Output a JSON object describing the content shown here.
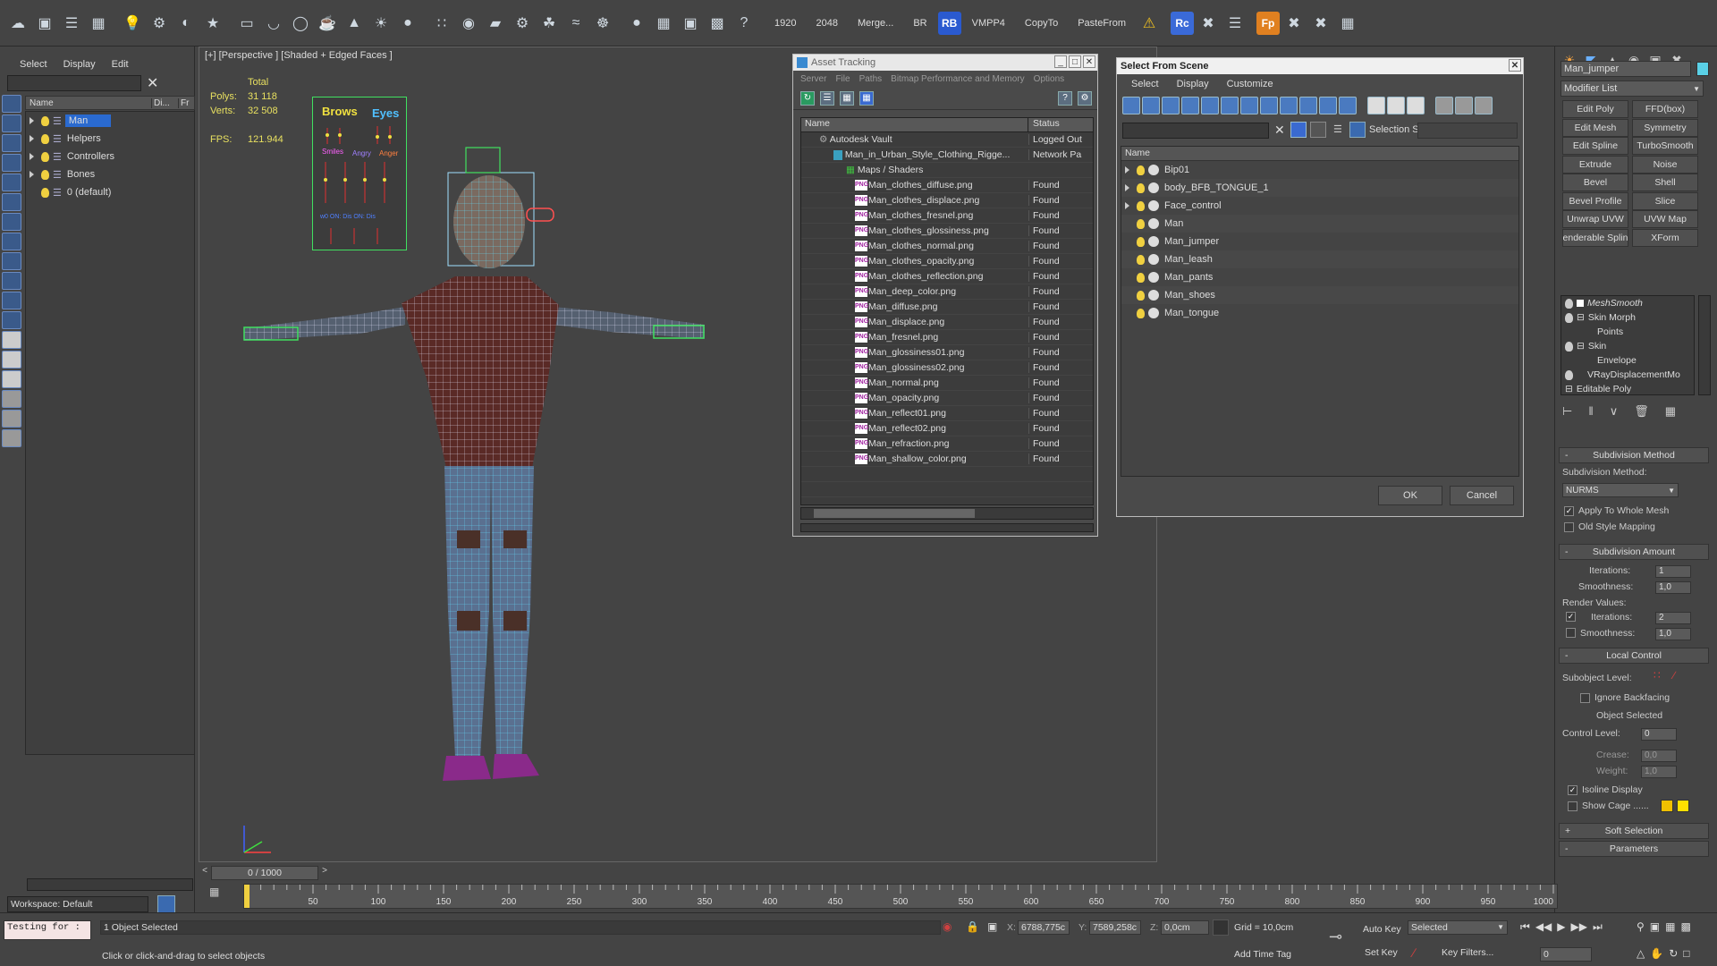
{
  "toolbar": {
    "fields": [
      "1920",
      "2048",
      "Merge...",
      "BR",
      "RB",
      "VMPP4",
      "CopyTo",
      "PasteFrom",
      "Rc",
      "Fp"
    ]
  },
  "scene_explorer": {
    "menu": [
      "Select",
      "Display",
      "Edit"
    ],
    "columns": [
      "Name",
      "Di...",
      "Fr"
    ],
    "items": [
      "Man",
      "Helpers",
      "Controllers",
      "Bones",
      "0 (default)"
    ],
    "workspace": "Workspace: Default"
  },
  "viewport": {
    "label": "[+] [Perspective ] [Shaded + Edged Faces ]",
    "stats_header": "Total",
    "polys_label": "Polys:",
    "polys_value": "31 118",
    "verts_label": "Verts:",
    "verts_value": "32 508",
    "fps_label": "FPS:",
    "fps_value": "121.944",
    "face_panel": [
      "Brows",
      "Eyes",
      "Smiles",
      "Angry",
      "Anger"
    ],
    "face_panel_bottom": "w0 ON: Dis ON: Dis"
  },
  "asset_tracking": {
    "title": "Asset Tracking",
    "menu": [
      "Server",
      "File",
      "Paths",
      "Bitmap Performance and Memory",
      "Options"
    ],
    "columns": [
      "Name",
      "Status"
    ],
    "root": {
      "name": "Autodesk Vault",
      "status": "Logged Out"
    },
    "file": {
      "name": "Man_in_Urban_Style_Clothing_Rigge...",
      "status": "Network Pa"
    },
    "folder": "Maps / Shaders",
    "maps": [
      {
        "name": "Man_clothes_diffuse.png",
        "status": "Found"
      },
      {
        "name": "Man_clothes_displace.png",
        "status": "Found"
      },
      {
        "name": "Man_clothes_fresnel.png",
        "status": "Found"
      },
      {
        "name": "Man_clothes_glossiness.png",
        "status": "Found"
      },
      {
        "name": "Man_clothes_normal.png",
        "status": "Found"
      },
      {
        "name": "Man_clothes_opacity.png",
        "status": "Found"
      },
      {
        "name": "Man_clothes_reflection.png",
        "status": "Found"
      },
      {
        "name": "Man_deep_color.png",
        "status": "Found"
      },
      {
        "name": "Man_diffuse.png",
        "status": "Found"
      },
      {
        "name": "Man_displace.png",
        "status": "Found"
      },
      {
        "name": "Man_fresnel.png",
        "status": "Found"
      },
      {
        "name": "Man_glossiness01.png",
        "status": "Found"
      },
      {
        "name": "Man_glossiness02.png",
        "status": "Found"
      },
      {
        "name": "Man_normal.png",
        "status": "Found"
      },
      {
        "name": "Man_opacity.png",
        "status": "Found"
      },
      {
        "name": "Man_reflect01.png",
        "status": "Found"
      },
      {
        "name": "Man_reflect02.png",
        "status": "Found"
      },
      {
        "name": "Man_refraction.png",
        "status": "Found"
      },
      {
        "name": "Man_shallow_color.png",
        "status": "Found"
      }
    ]
  },
  "select_scene": {
    "title": "Select From Scene",
    "menu": [
      "Select",
      "Display",
      "Customize"
    ],
    "selection_set_label": "Selection Set:",
    "column": "Name",
    "objects": [
      "Bip01",
      "body_BFB_TONGUE_1",
      "Face_control",
      "Man",
      "Man_jumper",
      "Man_leash",
      "Man_pants",
      "Man_shoes",
      "Man_tongue"
    ],
    "ok": "OK",
    "cancel": "Cancel"
  },
  "command_panel": {
    "object_name": "Man_jumper",
    "object_color": "#5ad0e6",
    "modifier_list": "Modifier List",
    "buttons": [
      "Edit Poly",
      "FFD(box)",
      "Edit Mesh",
      "Symmetry",
      "Edit Spline",
      "TurboSmooth",
      "Extrude",
      "Noise",
      "Bevel",
      "Shell",
      "Bevel Profile",
      "Slice",
      "Unwrap UVW",
      "UVW Map",
      "enderable Splin",
      "XForm"
    ],
    "stack": [
      "MeshSmooth",
      "Skin Morph",
      "Points",
      "Skin",
      "Envelope",
      "VRayDisplacementMo",
      "Editable Poly"
    ],
    "subdivision_method_title": "Subdivision Method",
    "subdivision_method_label": "Subdivision Method:",
    "subdivision_method_value": "NURMS",
    "apply_whole_mesh": "Apply To Whole Mesh",
    "old_style_mapping": "Old Style Mapping",
    "subdivision_amount_title": "Subdivision Amount",
    "iterations_label": "Iterations:",
    "iterations_value": "1",
    "smoothness_label": "Smoothness:",
    "smoothness_value": "1,0",
    "render_values_label": "Render Values:",
    "render_iterations_label": "Iterations:",
    "render_iterations_value": "2",
    "render_smoothness_label": "Smoothness:",
    "render_smoothness_value": "1,0",
    "local_control_title": "Local Control",
    "subobject_level_label": "Subobject Level:",
    "ignore_backfacing": "Ignore Backfacing",
    "object_selected": "Object Selected",
    "control_level_label": "Control Level:",
    "control_level_value": "0",
    "crease_label": "Crease:",
    "crease_value": "0,0",
    "weight_label": "Weight:",
    "weight_value": "1,0",
    "isoline_display": "Isoline Display",
    "show_cage": "Show Cage ......",
    "soft_selection_title": "Soft Selection",
    "parameters_title": "Parameters"
  },
  "timeline": {
    "frame_display": "0 / 1000",
    "ticks": [
      "50",
      "100",
      "150",
      "200",
      "250",
      "300",
      "350",
      "400",
      "450",
      "500",
      "550",
      "600",
      "650",
      "700",
      "750",
      "800",
      "850",
      "900",
      "950",
      "1000"
    ]
  },
  "status": {
    "script_listener": "Testing for :",
    "selection": "1 Object Selected",
    "prompt": "Click or click-and-drag to select objects",
    "x_label": "X:",
    "x_value": "6788,775c",
    "y_label": "Y:",
    "y_value": "7589,258c",
    "z_label": "Z:",
    "z_value": "0,0cm",
    "grid": "Grid = 10,0cm",
    "add_time_tag": "Add Time Tag",
    "auto_key": "Auto Key",
    "set_key": "Set Key",
    "key_mode": "Selected",
    "key_filters": "Key Filters...",
    "frame_value": "0"
  }
}
